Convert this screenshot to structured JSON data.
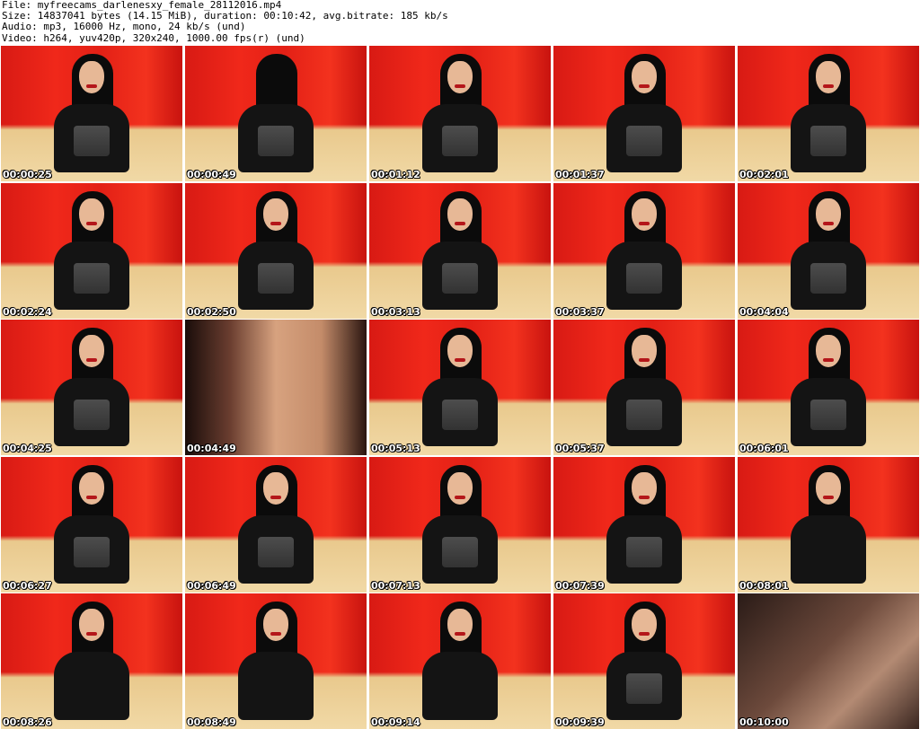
{
  "info": {
    "file": "File: myfreecams_darlenesxy_female_28112016.mp4",
    "size": "Size: 14837041 bytes (14.15 MiB), duration: 00:10:42, avg.bitrate: 185 kb/s",
    "audio": "Audio: mp3, 16000 Hz, mono, 24 kb/s (und)",
    "video": "Video: h264, yuv420p, 320x240, 1000.00 fps(r) (und)"
  },
  "thumbnails": [
    {
      "time": "00:00:25"
    },
    {
      "time": "00:00:49"
    },
    {
      "time": "00:01:12"
    },
    {
      "time": "00:01:37"
    },
    {
      "time": "00:02:01"
    },
    {
      "time": "00:02:24"
    },
    {
      "time": "00:02:50"
    },
    {
      "time": "00:03:13"
    },
    {
      "time": "00:03:37"
    },
    {
      "time": "00:04:04"
    },
    {
      "time": "00:04:25"
    },
    {
      "time": "00:04:49"
    },
    {
      "time": "00:05:13"
    },
    {
      "time": "00:05:37"
    },
    {
      "time": "00:06:01"
    },
    {
      "time": "00:06:27"
    },
    {
      "time": "00:06:49"
    },
    {
      "time": "00:07:13"
    },
    {
      "time": "00:07:39"
    },
    {
      "time": "00:08:01"
    },
    {
      "time": "00:08:26"
    },
    {
      "time": "00:08:49"
    },
    {
      "time": "00:09:14"
    },
    {
      "time": "00:09:39"
    },
    {
      "time": "00:10:00"
    }
  ]
}
